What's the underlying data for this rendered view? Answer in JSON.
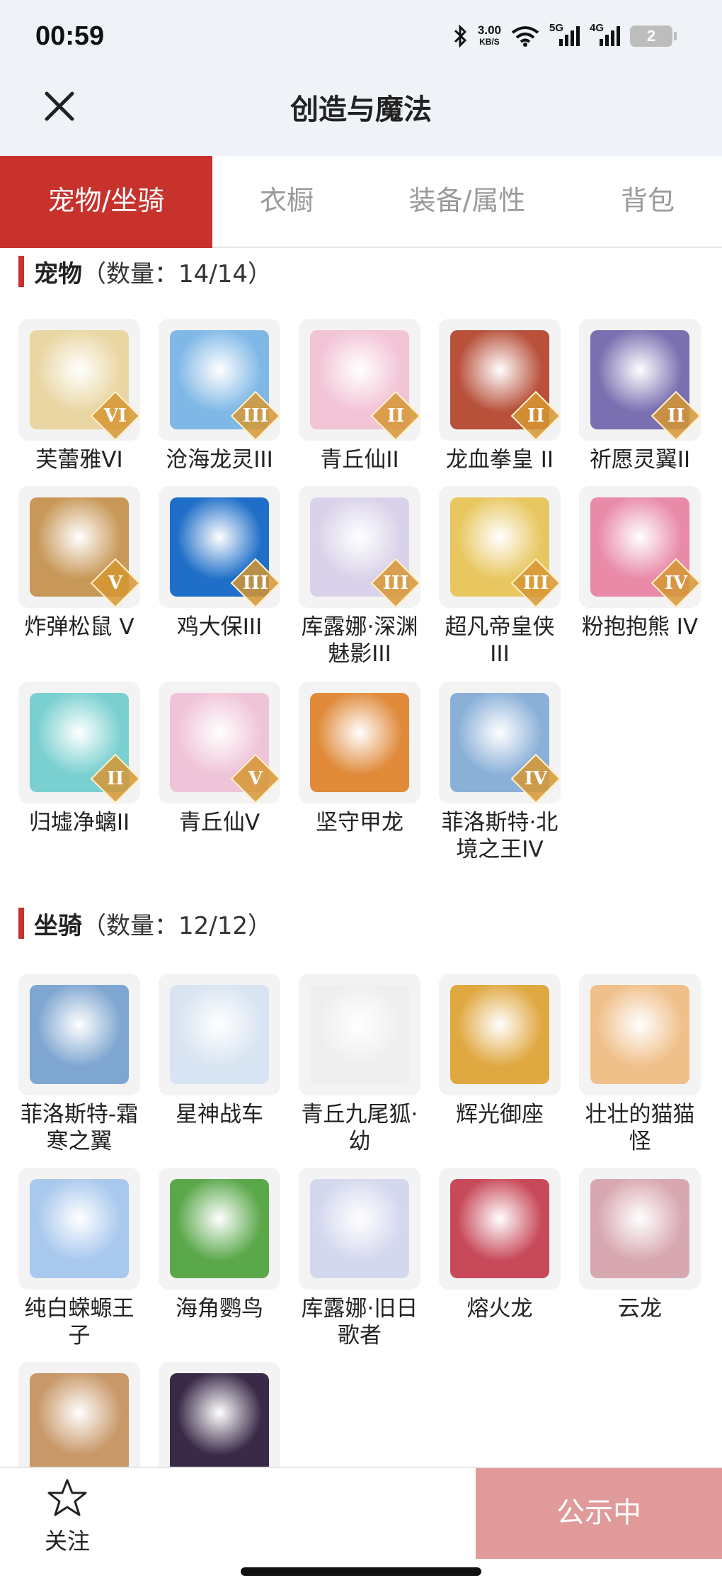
{
  "status": {
    "time": "00:59",
    "speed_value": "3.00",
    "speed_unit": "KB/S",
    "sig1": "5G",
    "sig2": "4G",
    "battery": "2"
  },
  "header": {
    "title": "创造与魔法"
  },
  "tabs": [
    {
      "label": "宠物/坐骑",
      "active": true
    },
    {
      "label": "衣橱",
      "active": false
    },
    {
      "label": "装备/属性",
      "active": false
    },
    {
      "label": "背包",
      "active": false
    }
  ],
  "pets": {
    "name": "宠物",
    "count": "（数量：14/14）",
    "items": [
      {
        "name": "芙蕾雅VI",
        "level": "VI"
      },
      {
        "name": "沧海龙灵III",
        "level": "III"
      },
      {
        "name": "青丘仙II",
        "level": "II"
      },
      {
        "name": "龙血拳皇 II",
        "level": "II"
      },
      {
        "name": "祈愿灵翼II",
        "level": "II"
      },
      {
        "name": "炸弹松鼠 V",
        "level": "V"
      },
      {
        "name": "鸡大保III",
        "level": "III"
      },
      {
        "name": "库露娜·深渊魅影III",
        "level": "III"
      },
      {
        "name": "超凡帝皇侠III",
        "level": "III"
      },
      {
        "name": "粉抱抱熊 IV",
        "level": "IV"
      },
      {
        "name": "归墟净螭II",
        "level": "II"
      },
      {
        "name": "青丘仙V",
        "level": "V"
      },
      {
        "name": "坚守甲龙",
        "level": ""
      },
      {
        "name": "菲洛斯特·北境之王IV",
        "level": "IV"
      }
    ]
  },
  "mounts": {
    "name": "坐骑",
    "count": "（数量：12/12）",
    "items": [
      {
        "name": "菲洛斯特-霜寒之翼",
        "level": ""
      },
      {
        "name": "星神战车",
        "level": ""
      },
      {
        "name": "青丘九尾狐·幼",
        "level": ""
      },
      {
        "name": "辉光御座",
        "level": ""
      },
      {
        "name": "壮壮的猫猫怪",
        "level": ""
      },
      {
        "name": "纯白蝾螈王子",
        "level": ""
      },
      {
        "name": "海角鹦鸟",
        "level": ""
      },
      {
        "name": "库露娜·旧日歌者",
        "level": ""
      },
      {
        "name": "熔火龙",
        "level": ""
      },
      {
        "name": "云龙",
        "level": ""
      },
      {
        "name": "",
        "level": ""
      },
      {
        "name": "",
        "level": ""
      }
    ]
  },
  "bottom": {
    "follow_label": "关注",
    "public_label": "公示中"
  },
  "colors": {
    "accent": "#c8322d",
    "public_button": "#e09a9a"
  },
  "art_colors": {
    "pets": [
      "#e9d6a2",
      "#7fb8e6",
      "#f2c4d6",
      "#b8503a",
      "#7a6fb0",
      "#c89858",
      "#1f6fc8",
      "#d9d2ea",
      "#e8c760",
      "#e88aa8",
      "#7ad0d0",
      "#f0c4d8",
      "#e08a3a",
      "#8ab0d8"
    ],
    "mounts": [
      "#7ea6d0",
      "#d8e4f2",
      "#eeeeee",
      "#e0a840",
      "#f0c08a",
      "#a8c8ee",
      "#5aa84a",
      "#d4d8ee",
      "#c84a5a",
      "#d8a8b0",
      "#c89868",
      "#3a2a48"
    ]
  }
}
